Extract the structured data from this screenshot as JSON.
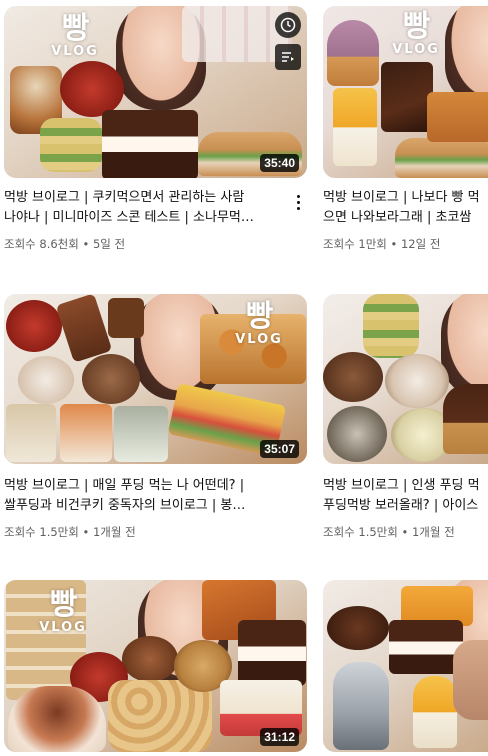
{
  "videos": [
    {
      "brand_big": "빵",
      "brand_sub": "VLOG",
      "duration": "35:40",
      "title_line1": "먹방 브이로그 | 쿠키먹으면서 관리하는 사람",
      "title_line2": "나야나 | 미니마이즈 스콘 테스트 | 소나무먹…",
      "views": "조회수 8.6천회",
      "age": "5일 전",
      "hover_icons": [
        "clock-icon",
        "add-to-queue-icon"
      ],
      "menu_icon": "more-vert-icon"
    },
    {
      "brand_big": "빵",
      "brand_sub": "VLOG",
      "duration": "",
      "title_line1": "먹방 브이로그 | 나보다 빵 먹",
      "title_line2": "으면 나와보라그래 | 초코쌈",
      "views": "조회수 1만회",
      "age": "12일 전"
    },
    {
      "brand_big": "빵",
      "brand_sub": "VLOG",
      "duration": "35:07",
      "title_line1": "먹방 브이로그 | 매일 푸딩 먹는 나 어떤데? |",
      "title_line2": "쌀푸딩과 비건쿠키 중독자의 브이로그 | 봉…",
      "views": "조회수 1.5만회",
      "age": "1개월 전"
    },
    {
      "brand_big": "",
      "brand_sub": "",
      "duration": "",
      "title_line1": "먹방 브이로그 | 인생 푸딩 먹",
      "title_line2": "푸딩먹방 보러올래? | 아이스",
      "views": "조회수 1.5만회",
      "age": "1개월 전"
    },
    {
      "brand_big": "빵",
      "brand_sub": "VLOG",
      "duration": "31:12"
    },
    {
      "brand_big": "",
      "brand_sub": ""
    }
  ],
  "separator": "•",
  "colors": {
    "text_primary": "#0f0f0f",
    "text_secondary": "#606060",
    "badge_bg": "#000000cc"
  }
}
